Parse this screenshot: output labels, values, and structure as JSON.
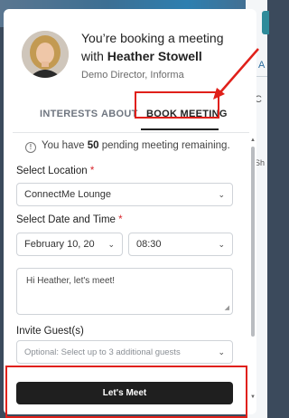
{
  "header": {
    "line1": "You’re booking a meeting",
    "line2_prefix": "with ",
    "name": "Heather Stowell",
    "subtitle": "Demo Director, Informa"
  },
  "tabs": [
    {
      "label": "INTERESTS"
    },
    {
      "label": "ABOUT"
    },
    {
      "label": "BOOK MEETING"
    }
  ],
  "info": {
    "prefix": "You have ",
    "count": "50",
    "suffix": " pending meeting remaining."
  },
  "location": {
    "label": "Select Location",
    "required_mark": "*",
    "value": "ConnectMe Lounge"
  },
  "datetime": {
    "label": "Select Date and Time",
    "required_mark": "*",
    "date_value": "February 10, 20",
    "time_value": "08:30"
  },
  "message": {
    "value": "Hi Heather, let's meet!"
  },
  "guests": {
    "label": "Invite Guest(s)",
    "placeholder": "Optional: Select up to 3 additional guests"
  },
  "cta": {
    "label": "Let's Meet"
  },
  "background": {
    "side_text_1": "A",
    "side_text_2": "C",
    "side_text_3": "Sh"
  },
  "colors": {
    "annotation_red": "#e0201a",
    "required_red": "#d8262c",
    "cta_bg": "#1f1f1f"
  }
}
